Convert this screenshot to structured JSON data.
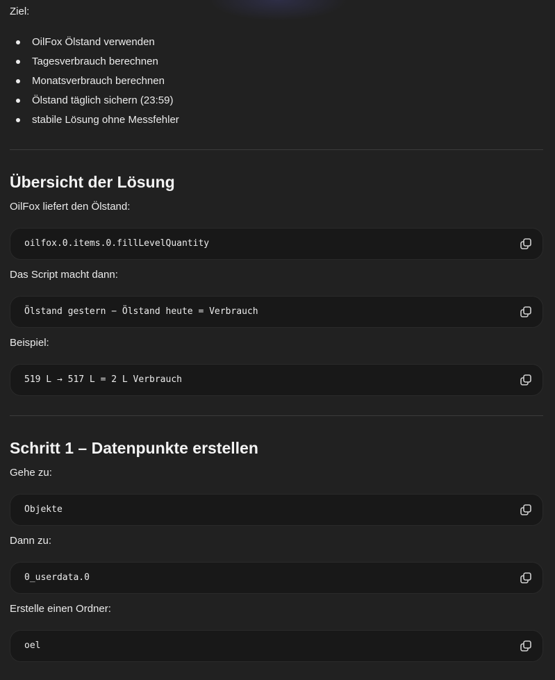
{
  "goal_label": "Ziel:",
  "goals": [
    "OilFox Ölstand verwenden",
    "Tagesverbrauch berechnen",
    "Monatsverbrauch berechnen",
    "Ölstand täglich sichern (23:59)",
    "stabile Lösung ohne Messfehler"
  ],
  "section1": {
    "heading": "Übersicht der Lösung",
    "text1": "OilFox liefert den Ölstand:",
    "code1": "oilfox.0.items.0.fillLevelQuantity",
    "text2": "Das Script macht dann:",
    "code2": "Ölstand gestern − Ölstand heute = Verbrauch",
    "text3": "Beispiel:",
    "code3": "519 L → 517 L = 2 L Verbrauch"
  },
  "section2": {
    "heading": "Schritt 1 – Datenpunkte erstellen",
    "text1": "Gehe zu:",
    "code1": "Objekte",
    "text2": "Dann zu:",
    "code2": "0_userdata.0",
    "text3": "Erstelle einen Ordner:",
    "code3": "oel"
  },
  "icons": {
    "copy": "copy-icon"
  }
}
